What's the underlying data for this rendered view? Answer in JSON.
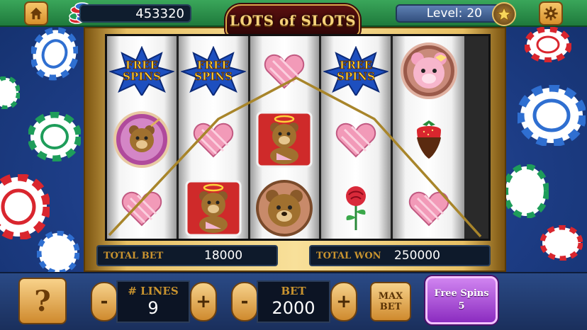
{
  "header": {
    "credits": "453320",
    "level_label": "Level:",
    "level_value": "20",
    "logo_text": "LOTS of SLOTS"
  },
  "icons": {
    "home": "home-icon",
    "settings": "gear-icon",
    "level_badge": "star-icon",
    "coins": "chip-stack-icon"
  },
  "reels": [
    [
      "free-spins",
      "cupid-bear-badge",
      "heart-box"
    ],
    [
      "free-spins",
      "heart-box",
      "angel-bear-tile"
    ],
    [
      "heart-box",
      "angel-bear-tile",
      "bear-face-badge"
    ],
    [
      "free-spins",
      "heart-box",
      "rose"
    ],
    [
      "pink-bear-badge",
      "chocolate-strawberry",
      "heart-box"
    ]
  ],
  "symbol_text": {
    "free_spins_line1": "FREE",
    "free_spins_line2": "SPINS"
  },
  "info": {
    "total_bet_label": "TOTAL BET",
    "total_bet_value": "18000",
    "total_won_label": "TOTAL WON",
    "total_won_value": "250000"
  },
  "controls": {
    "help_label": "?",
    "minus": "-",
    "plus": "+",
    "lines_label": "# LINES",
    "lines_value": "9",
    "bet_label": "BET",
    "bet_value": "2000",
    "max_bet_line1": "MAX",
    "max_bet_line2": "BET",
    "free_spins_label": "Free Spins",
    "free_spins_count": "5"
  },
  "colors": {
    "table_blue": "#1d3d86",
    "gold": "#c8932f",
    "free_spins_purple": "#9b3ad0",
    "top_bar_green": "#2b8d48"
  }
}
